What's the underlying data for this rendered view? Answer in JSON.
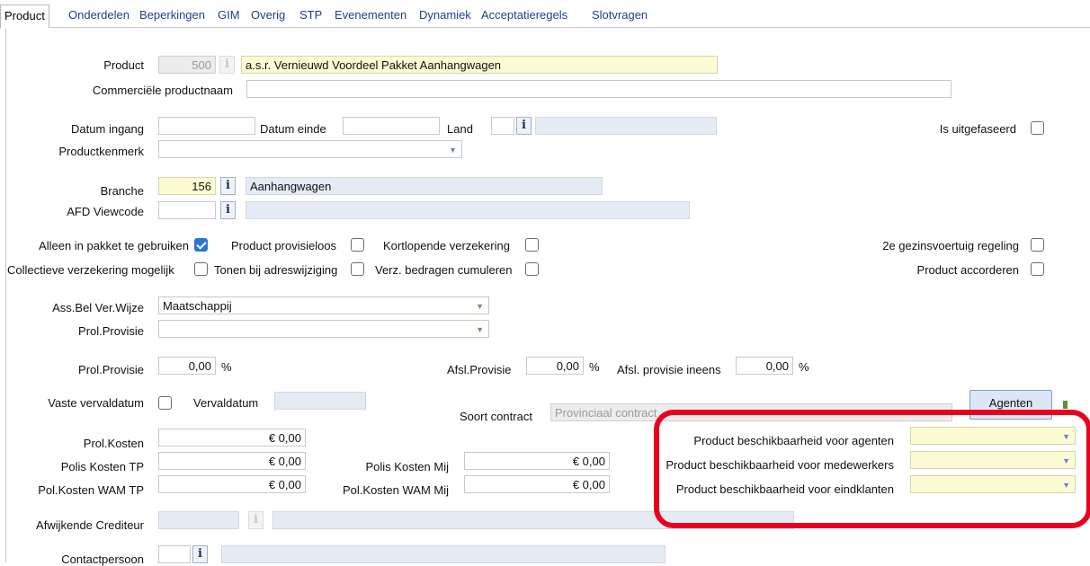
{
  "tabs": [
    "Product",
    "Onderdelen",
    "Beperkingen",
    "GIM",
    "Overig",
    "STP",
    "Evenementen",
    "Dynamiek",
    "Acceptatieregels",
    "Slotvragen"
  ],
  "labels": {
    "product": "Product",
    "commerciele_productnaam": "Commerciële productnaam",
    "datum_ingang": "Datum ingang",
    "datum_einde": "Datum einde",
    "land": "Land",
    "is_uitgefaseerd": "Is uitgefaseerd",
    "productkenmerk": "Productkenmerk",
    "branche": "Branche",
    "afd_viewcode": "AFD Viewcode",
    "alleen_in_pakket": "Alleen in pakket te gebruiken",
    "product_provisieloos": "Product provisieloos",
    "kortlopende_verzekering": "Kortlopende verzekering",
    "gezinsvoertuig": "2e gezinsvoertuig regeling",
    "collectieve": "Collectieve verzekering mogelijk",
    "tonen_adreswijziging": "Tonen bij adreswijziging",
    "verz_bedragen": "Verz. bedragen cumuleren",
    "product_accorderen": "Product accorderen",
    "ass_bel": "Ass.Bel Ver.Wijze",
    "prol_provisie": "Prol.Provisie",
    "prol_provisie2": "Prol.Provisie",
    "afsl_provisie": "Afsl.Provisie",
    "afsl_provisie_ineens": "Afsl. provisie ineens",
    "vaste_vervaldatum": "Vaste vervaldatum",
    "vervaldatum": "Vervaldatum",
    "soort_contract": "Soort contract",
    "prol_kosten": "Prol.Kosten",
    "polis_kosten_tp": "Polis Kosten TP",
    "pol_kosten_wam_tp": "Pol.Kosten WAM TP",
    "polis_kosten_mij": "Polis Kosten Mij",
    "pol_kosten_wam_mij": "Pol.Kosten WAM Mij",
    "beschikbaar_agenten": "Product beschikbaarheid voor agenten",
    "beschikbaar_medewerkers": "Product beschikbaarheid voor medewerkers",
    "beschikbaar_eindklanten": "Product beschikbaarheid voor eindklanten",
    "afwijkende_crediteur": "Afwijkende Crediteur",
    "contactpersoon": "Contactpersoon",
    "pct": "%"
  },
  "values": {
    "product_code": "500",
    "product_name": "a.s.r. Vernieuwd Voordeel Pakket Aanhangwagen",
    "commerciele_productnaam": "",
    "branche_code": "156",
    "branche_name": "Aanhangwagen",
    "ass_bel": "Maatschappij",
    "prol_provisie_pct": "0,00",
    "afsl_provisie_pct": "0,00",
    "afsl_provisie_ineens_pct": "0,00",
    "soort_contract": "Provinciaal contract",
    "prol_kosten": "€ 0,00",
    "polis_kosten_tp": "€ 0,00",
    "pol_kosten_wam_tp": "€ 0,00",
    "polis_kosten_mij": "€ 0,00",
    "pol_kosten_wam_mij": "€ 0,00"
  },
  "checkboxes": {
    "is_uitgefaseerd": false,
    "alleen_in_pakket": true,
    "product_provisieloos": false,
    "kortlopende_verzekering": false,
    "gezinsvoertuig": false,
    "collectieve": false,
    "tonen_adreswijziging": false,
    "verz_bedragen": false,
    "product_accorderen": false,
    "vaste_vervaldatum": false
  },
  "buttons": {
    "agenten": "Agenten"
  },
  "icons": {
    "info": "i",
    "dropdown": "▼"
  },
  "colors": {
    "highlight": "#e8001e",
    "readonly_field": "#e4ebf5",
    "required_field": "#fdfbd4",
    "checkbox_on": "#2e74d6"
  }
}
